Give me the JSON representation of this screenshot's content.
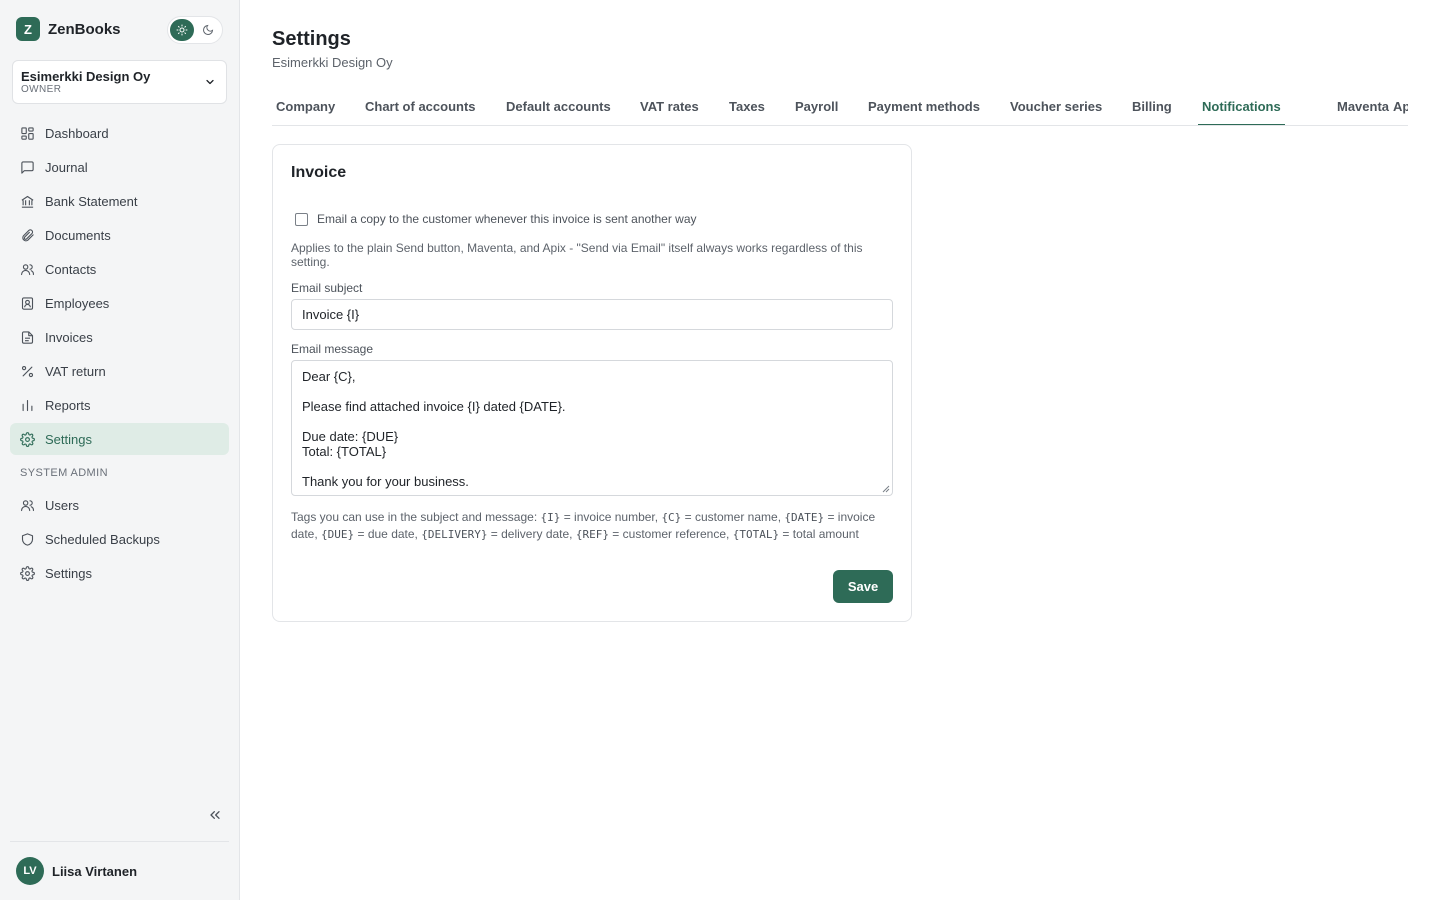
{
  "brand": {
    "logo_letter": "Z",
    "name": "ZenBooks"
  },
  "org": {
    "name": "Esimerkki Design Oy",
    "role": "OWNER"
  },
  "nav": {
    "items": [
      {
        "label": "Dashboard",
        "icon": "dashboard-icon"
      },
      {
        "label": "Journal",
        "icon": "chat-icon"
      },
      {
        "label": "Bank Statement",
        "icon": "bank-icon"
      },
      {
        "label": "Documents",
        "icon": "paperclip-icon"
      },
      {
        "label": "Contacts",
        "icon": "people-icon"
      },
      {
        "label": "Employees",
        "icon": "id-badge-icon"
      },
      {
        "label": "Invoices",
        "icon": "document-icon"
      },
      {
        "label": "VAT return",
        "icon": "percent-icon"
      },
      {
        "label": "Reports",
        "icon": "bar-chart-icon"
      },
      {
        "label": "Settings",
        "icon": "gear-icon",
        "active": true
      }
    ],
    "admin_section": "SYSTEM ADMIN",
    "admin_items": [
      {
        "label": "Users",
        "icon": "people-icon"
      },
      {
        "label": "Scheduled Backups",
        "icon": "shield-icon"
      },
      {
        "label": "Settings",
        "icon": "gear-icon"
      }
    ]
  },
  "user": {
    "initials": "LV",
    "name": "Liisa Virtanen"
  },
  "page": {
    "title": "Settings",
    "subtitle": "Esimerkki Design Oy"
  },
  "tabs": [
    "Company",
    "Chart of accounts",
    "Default accounts",
    "VAT rates",
    "Taxes",
    "Payroll",
    "Payment methods",
    "Voucher series",
    "Billing",
    "Notifications",
    "Maventa",
    "Apix"
  ],
  "active_tab": "Notifications",
  "card": {
    "title": "Invoice",
    "checkbox_label": "Email a copy to the customer whenever this invoice is sent another way",
    "checkbox_checked": false,
    "help": "Applies to the plain Send button, Maventa, and Apix - \"Send via Email\" itself always works regardless of this setting.",
    "subject_label": "Email subject",
    "subject_value": "Invoice {I}",
    "message_label": "Email message",
    "message_lines": [
      "Dear {C},",
      "",
      "Please find attached invoice {I} dated {DATE}.",
      "",
      "Due date: {DUE}",
      "Total: {TOTAL}",
      "",
      "Thank you for your business."
    ],
    "tags": {
      "intro": "Tags you can use in the subject and message: ",
      "t1": "{I}",
      "d1": " = invoice number, ",
      "t2": "{C}",
      "d2": " = customer name, ",
      "t3": "{DATE}",
      "d3": " = invoice date, ",
      "t4": "{DUE}",
      "d4": " = due date, ",
      "t5": "{DELIVERY}",
      "d5": " = delivery date, ",
      "t6": "{REF}",
      "d6": " = customer reference, ",
      "t7": "{TOTAL}",
      "d7": " = total amount"
    },
    "save_label": "Save"
  },
  "colors": {
    "accent": "#2e6b57",
    "active_bg": "#dfece6",
    "sidebar_bg": "#f4f5f6"
  }
}
